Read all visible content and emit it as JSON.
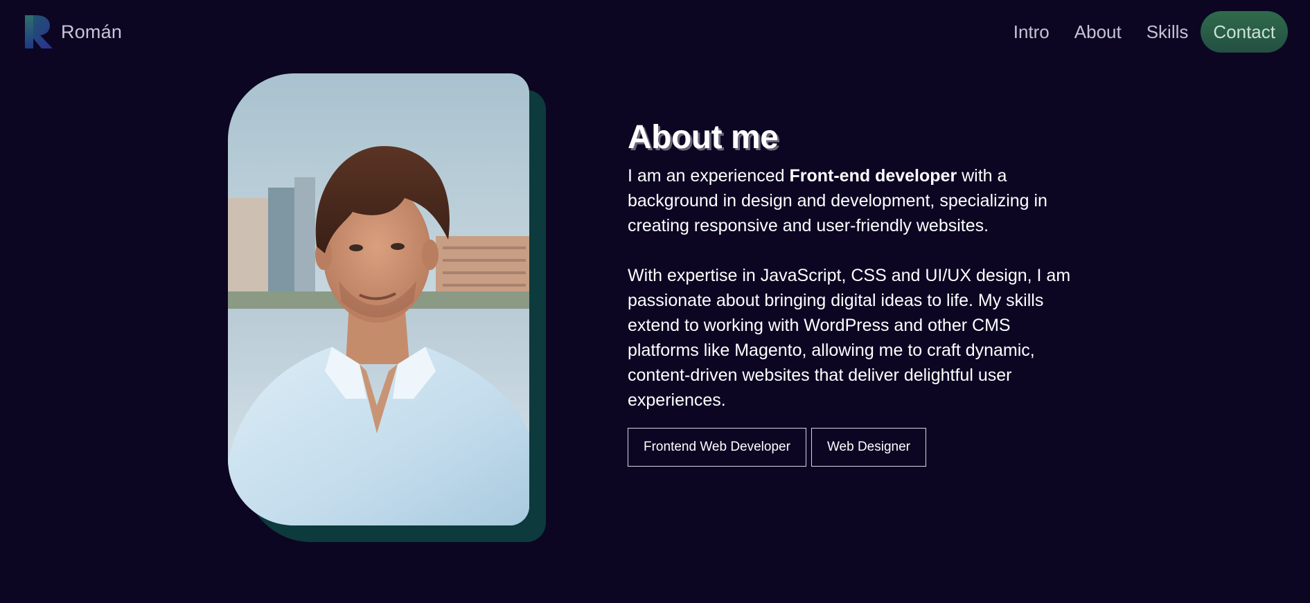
{
  "header": {
    "brand_name": "Román",
    "nav": [
      {
        "label": "Intro"
      },
      {
        "label": "About"
      },
      {
        "label": "Skills"
      },
      {
        "label": "Contact"
      }
    ]
  },
  "about": {
    "title": "About me",
    "p1_before": "I am an experienced ",
    "p1_bold": "Front-end developer",
    "p1_after": " with a background in design and development, specializing in creating responsive and user-friendly websites.",
    "p2": "With expertise in JavaScript, CSS and UI/UX design, I am passionate about bringing digital ideas to life. My skills extend to working with WordPress and other CMS platforms like Magento, allowing me to craft dynamic, content-driven websites that deliver delightful user experiences.",
    "tags": [
      {
        "label": "Frontend Web Developer"
      },
      {
        "label": "Web Designer"
      }
    ]
  },
  "colors": {
    "background": "#0c0623",
    "contact_button": "#2f6b4c",
    "photo_shadow": "#0d3a3d"
  },
  "icons": {
    "logo": "r-letter-logo"
  }
}
